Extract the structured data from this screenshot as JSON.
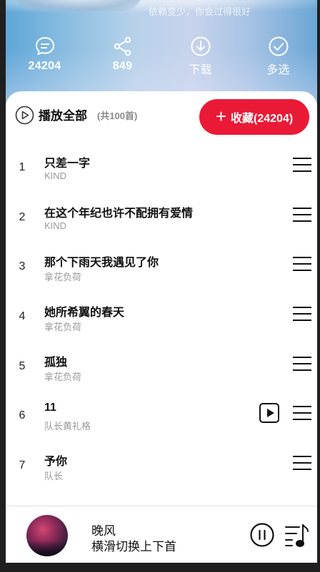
{
  "header": {
    "subtitle": "依赖变少，你会过得很好",
    "actions": [
      {
        "icon": "comment-icon",
        "label": "24204"
      },
      {
        "icon": "share-icon",
        "label": "849"
      },
      {
        "icon": "download-icon",
        "label": "下载"
      },
      {
        "icon": "multi-select-icon",
        "label": "多选"
      }
    ]
  },
  "playbar": {
    "play_all_label": "播放全部",
    "count_label": "(共100首)",
    "collect_label": "收藏(24204)"
  },
  "songs": [
    {
      "index": "1",
      "title": "只差一字",
      "artist": "KIND",
      "has_mv": false
    },
    {
      "index": "2",
      "title": "在这个年纪也许不配拥有爱情",
      "artist": "KIND",
      "has_mv": false
    },
    {
      "index": "3",
      "title": "那个下雨天我遇见了你",
      "artist": "拿花负荷",
      "has_mv": false
    },
    {
      "index": "4",
      "title": "她所希翼的春天",
      "artist": "拿花负荷",
      "has_mv": false
    },
    {
      "index": "5",
      "title": "孤独",
      "artist": "拿花负荷",
      "has_mv": false
    },
    {
      "index": "6",
      "title": "11",
      "artist": "队长黄礼格",
      "has_mv": true
    },
    {
      "index": "7",
      "title": "予你",
      "artist": "队长",
      "has_mv": false
    }
  ],
  "player": {
    "title": "晚风",
    "subtitle": "横滑切换上下首"
  },
  "colors": {
    "accent": "#ea1a36",
    "text": "#111111",
    "muted": "#999999"
  }
}
